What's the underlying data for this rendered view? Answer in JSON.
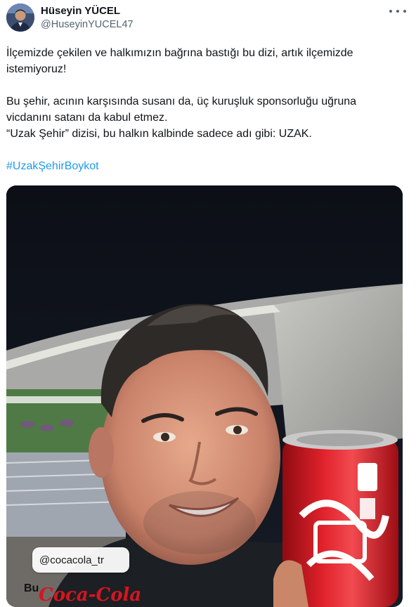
{
  "author": {
    "name": "Hüseyin YÜCEL",
    "handle": "@HuseyinYUCEL47",
    "avatar_icon": "user-avatar"
  },
  "tweet": {
    "paragraphs": [
      [
        "İlçemizde çekilen ve halkımızın bağrına bastığı bu dizi, artık ilçemizde",
        "istemiyoruz!"
      ],
      [
        "Bu şehir, acının karşısında susanı da, üç kuruşluk sponsorluğu uğruna",
        "vicdanını satanı da kabul etmez.",
        "“Uzak Şehir” dizisi, bu halkın kalbinde sadece adı gibi: UZAK."
      ]
    ],
    "hashtag": "#UzakŞehirBoykot"
  },
  "media": {
    "tag_label": "@cocacola_tr",
    "bottom_text": "Bu",
    "brand_script": "Coca-Cola"
  },
  "colors": {
    "text": "#0f1419",
    "secondary": "#536471",
    "link": "#1d9bf0",
    "brand_red": "#d5151e"
  }
}
